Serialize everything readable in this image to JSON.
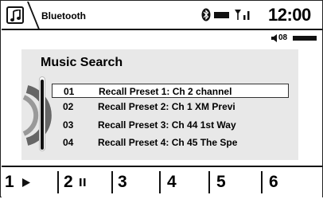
{
  "topbar": {
    "source_icon": "music-note-icon",
    "source_label": "Bluetooth",
    "status_icons": [
      "bluetooth-icon",
      "battery-icon",
      "signal-icon"
    ],
    "clock": "12:00"
  },
  "volume": {
    "icon": "speaker-icon",
    "value": "08"
  },
  "music_search": {
    "title": "Music Search",
    "items": [
      {
        "num": "01",
        "label": "Recall Preset 1: Ch 2 channel",
        "selected": true
      },
      {
        "num": "02",
        "label": "Recall Preset 2: Ch 1 XM Previ",
        "selected": false
      },
      {
        "num": "03",
        "label": "Recall Preset 3: Ch 44 1st Way",
        "selected": false
      },
      {
        "num": "04",
        "label": "Recall Preset 4: Ch 45 The Spe",
        "selected": false
      }
    ]
  },
  "presets": [
    {
      "num": "1",
      "icon": "play-icon"
    },
    {
      "num": "2",
      "icon": "pause-icon"
    },
    {
      "num": "3",
      "icon": ""
    },
    {
      "num": "4",
      "icon": ""
    },
    {
      "num": "5",
      "icon": ""
    },
    {
      "num": "6",
      "icon": ""
    }
  ]
}
